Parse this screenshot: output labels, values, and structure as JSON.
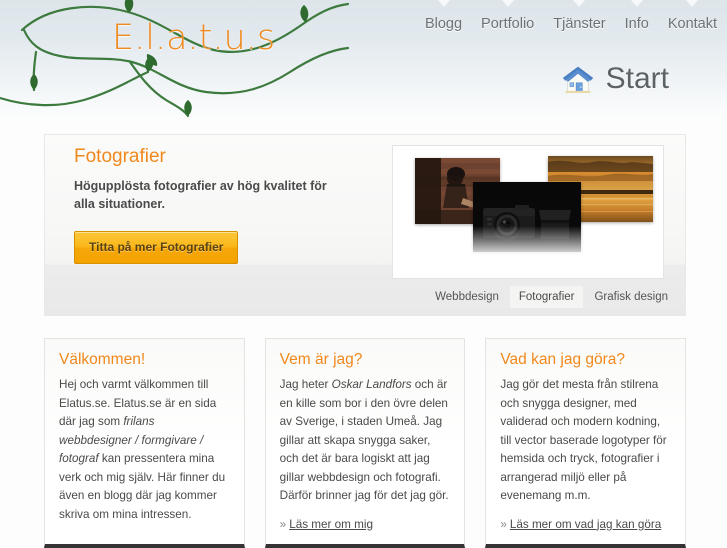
{
  "header": {
    "logo": "E.l.a.t.u.s",
    "nav": [
      {
        "label": "Blogg"
      },
      {
        "label": "Portfolio"
      },
      {
        "label": "Tjänster"
      },
      {
        "label": "Info"
      },
      {
        "label": "Kontakt"
      }
    ],
    "page_title": "Start",
    "page_title_icon": "house-icon",
    "vine_color": "#3d7a3d",
    "logo_color": "#f08a1e"
  },
  "banner": {
    "title": "Fotografier",
    "subtitle": "Högupplösta fotografier av hög kvalitet för alla situationer.",
    "button_label": "Titta på mer Fotografier",
    "photos": [
      {
        "name": "girl-brick-wall-photo"
      },
      {
        "name": "sunset-lake-photo"
      },
      {
        "name": "camera-product-photo"
      }
    ],
    "tabs": [
      {
        "label": "Webbdesign",
        "active": false
      },
      {
        "label": "Fotografier",
        "active": true
      },
      {
        "label": "Grafisk design",
        "active": false
      }
    ]
  },
  "columns": [
    {
      "title": "Välkommen!",
      "body_pre": "Hej och varmt välkommen till Elatus.se. Elatus.se är en sida där jag som ",
      "body_em": "frilans webbdesigner / formgivare / fotograf",
      "body_post": " kan pressentera mina verk och mig själv. Här finner du även en blogg där jag kommer skriva om mina intressen.",
      "link": null,
      "link_chevron": null
    },
    {
      "title": "Vem är jag?",
      "body_pre": "Jag heter ",
      "body_em": "Oskar Landfors",
      "body_post": " och är en kille som bor i den övre delen av Sverige, i staden Umeå. Jag gillar att skapa snygga saker, och det är bara logiskt att jag gillar webbdesign och fotografi. Därför brinner jag för det jag gör.",
      "link": "Läs mer om mig",
      "link_chevron": "»"
    },
    {
      "title": "Vad kan jag göra?",
      "body_pre": "Jag gör det mesta från stilrena och snygga designer, med validerad och modern kodning, till vector baserade logotyper för hemsida och tryck, fotografier i arrangerad miljö eller på evenemang m.m.",
      "body_em": null,
      "body_post": null,
      "link": "Läs mer om vad jag kan göra",
      "link_chevron": "»"
    }
  ],
  "colors": {
    "accent_orange": "#f0881c",
    "button_orange": "#f9b718",
    "header_blue": "#dde5ea",
    "text_gray": "#4a4a4a",
    "col_bottom_border": "#333333"
  }
}
